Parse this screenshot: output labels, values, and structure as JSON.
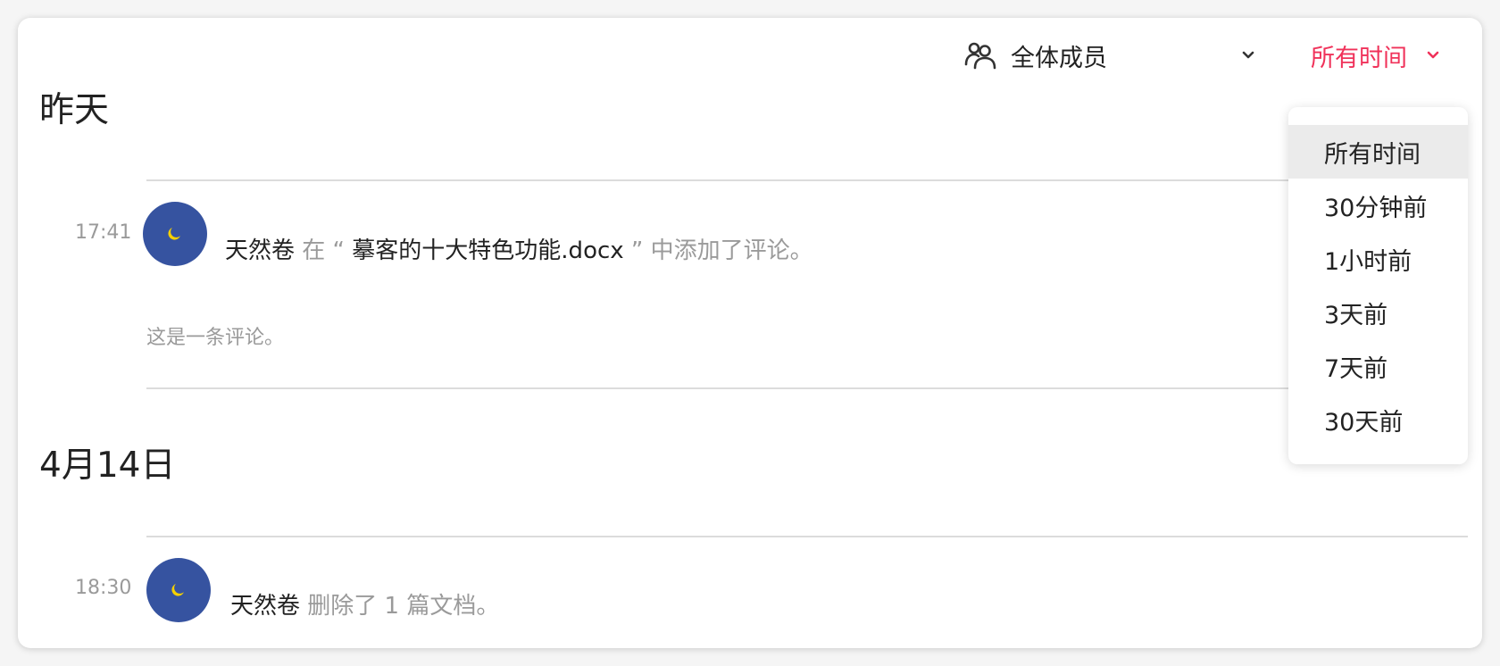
{
  "filters": {
    "member_label": "全体成员",
    "member_icon": "people-icon",
    "time_label": "所有时间",
    "accent_color": "#f0325a"
  },
  "time_dropdown": {
    "options": [
      "所有时间",
      "30分钟前",
      "1小时前",
      "3天前",
      "7天前",
      "30天前"
    ],
    "selected_index": 0
  },
  "sections": [
    {
      "date_label": "昨天",
      "activities": [
        {
          "time": "17:41",
          "user": "天然卷",
          "pre_text": "在 “",
          "document": "摹客的十大特色功能.docx",
          "post_text": "” 中添加了评论。",
          "comment": "这是一条评论。"
        }
      ]
    },
    {
      "date_label": "4月14日",
      "activities": [
        {
          "time": "18:30",
          "user": "天然卷",
          "action": "删除了 1 篇文档。"
        }
      ]
    }
  ],
  "avatar": {
    "background": "#3653a0",
    "icon": "moon-icon",
    "icon_color": "#f5d000"
  }
}
